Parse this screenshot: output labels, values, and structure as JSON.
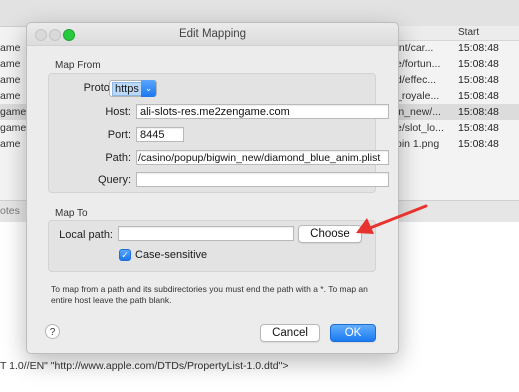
{
  "background": {
    "column_header": "Start",
    "rows": [
      {
        "left": "ame",
        "path": "fnt/car...",
        "time": "15:08:48",
        "selected": false
      },
      {
        "left": "ame",
        "path": "e/fortun...",
        "time": "15:08:48",
        "selected": false
      },
      {
        "left": "ame",
        "path": "d/effec...",
        "time": "15:08:48",
        "selected": false
      },
      {
        "left": "ame",
        "path": "_royale...",
        "time": "15:08:48",
        "selected": false
      },
      {
        "left": "game",
        "path": "in_new/...",
        "time": "15:08:48",
        "selected": true
      },
      {
        "left": "game",
        "path": "e/slot_lo...",
        "time": "15:08:48",
        "selected": false
      },
      {
        "left": "ame",
        "path": "oin 1.png",
        "time": "15:08:48",
        "selected": false
      }
    ],
    "divider_label": "otes",
    "footer_text": "T 1.0//EN\" \"http://www.apple.com/DTDs/PropertyList-1.0.dtd\">"
  },
  "dialog": {
    "title": "Edit Mapping",
    "map_from": {
      "label": "Map From",
      "protocol_label": "Protocol:",
      "protocol_value": "https",
      "host_label": "Host:",
      "host_value": "ali-slots-res.me2zengame.com",
      "port_label": "Port:",
      "port_value": "8445",
      "path_label": "Path:",
      "path_value": "/casino/popup/bigwin_new/diamond_blue_anim.plist",
      "query_label": "Query:",
      "query_value": ""
    },
    "map_to": {
      "label": "Map To",
      "local_path_label": "Local path:",
      "local_path_value": "",
      "choose_label": "Choose",
      "case_sensitive_label": "Case-sensitive",
      "case_sensitive_checked": true
    },
    "help_text": "To map from a path and its subdirectories you must end the path with a *. To map an entire host leave the path blank.",
    "help_button": "?",
    "cancel_label": "Cancel",
    "ok_label": "OK"
  },
  "annotation": {
    "arrow_color": "#e8322d"
  }
}
